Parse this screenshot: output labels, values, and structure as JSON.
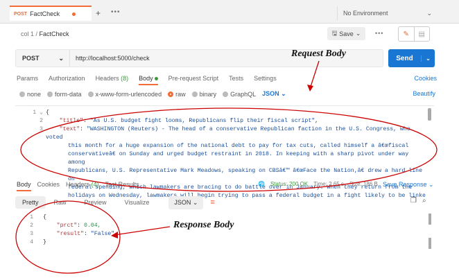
{
  "tab": {
    "method": "POST",
    "name": "FactCheck"
  },
  "environment": "No Environment",
  "breadcrumb": {
    "collection": "col 1",
    "request": "FactCheck"
  },
  "save_label": "Save",
  "request": {
    "method": "POST",
    "url": "http://localhost:5000/check"
  },
  "send_label": "Send",
  "request_tabs": [
    "Params",
    "Authorization",
    "Headers",
    "Body",
    "Pre-request Script",
    "Tests",
    "Settings"
  ],
  "headers_count": "(8)",
  "cookies_label": "Cookies",
  "body_options": [
    "none",
    "form-data",
    "x-www-form-urlencoded",
    "raw",
    "binary",
    "GraphQL"
  ],
  "body_format": "JSON",
  "beautify_label": "Beautify",
  "request_body": {
    "line1": "{",
    "title_key": "\"title\"",
    "title_val": "\"As U.S. budget fight looms, Republicans flip their fiscal script\"",
    "text_key": "\"text\"",
    "text_val": "\"WASHINGTON (Reuters) - The head of a conservative Republican faction in the U.S. Congress, who voted",
    "wrap_lines": [
      "this month for a huge expansion of the national debt to pay for tax cuts, called himself a â€œfiscal",
      "conservativeâ€ on Sunday and urged budget restraint in 2018. In keeping with a sharp pivot under way among",
      "Republicans, U.S. Representative Mark Meadows, speaking on CBSâ€™ â€œFace the Nation,â€ drew a hard line on",
      "federal spending, which lawmakers are bracing to do battle over in January. When they return from the",
      "holidays on Wednesday, lawmakers will begin trying to pass a federal budget in a fight likely to be linked"
    ]
  },
  "response_tabs": [
    "Body",
    "Cookies",
    "Headers",
    "Test Results"
  ],
  "response_headers_count": "(4)",
  "status": {
    "status": "Status: 200 OK",
    "time": "Time: 2.65 s",
    "size": "Size: 186 B"
  },
  "save_response_label": "Save Response",
  "response_views": [
    "Pretty",
    "Raw",
    "Preview",
    "Visualize"
  ],
  "response_format": "JSON",
  "response_body": {
    "open": "{",
    "prct_key": "\"prct\"",
    "prct_val": "0.04,",
    "result_key": "\"result\"",
    "result_val": "\"False\"",
    "close": "}"
  },
  "annotations": {
    "request": "Request Body",
    "response": "Response Body"
  },
  "colors": {
    "accent": "#f26b3a",
    "primary": "#1976d2",
    "annotation": "#cc0000"
  }
}
